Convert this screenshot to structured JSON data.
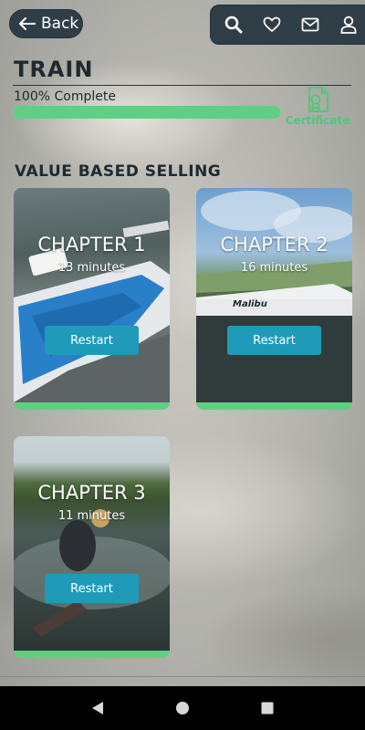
{
  "header": {
    "back_label": "Back",
    "icons": [
      "search-icon",
      "heart-icon",
      "mail-icon",
      "user-icon"
    ]
  },
  "page": {
    "title": "TRAIN",
    "progress_label": "100% Complete",
    "progress_percent": 100,
    "certificate_label": "Certificate"
  },
  "section": {
    "title": "VALUE BASED SELLING"
  },
  "chapters": [
    {
      "title": "CHAPTER 1",
      "duration": "13 minutes",
      "button": "Restart",
      "image_caption": ""
    },
    {
      "title": "CHAPTER 2",
      "duration": "16 minutes",
      "button": "Restart",
      "image_caption": "Malibu"
    },
    {
      "title": "CHAPTER 3",
      "duration": "11 minutes",
      "button": "Restart",
      "image_caption": ""
    }
  ],
  "colors": {
    "accent_green": "#5fcf83",
    "button_blue": "#1f9bb9",
    "header_dark": "#2f3e46"
  }
}
